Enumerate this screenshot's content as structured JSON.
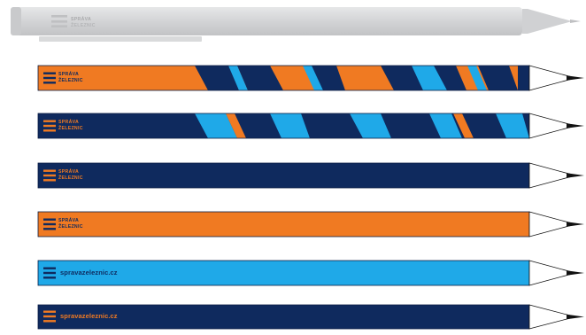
{
  "colors": {
    "navy": "#0f2a5e",
    "orange": "#f07a22",
    "cyan": "#1fa9e8",
    "pen_silver": "#cfd0d2",
    "pen_shadow": "#b8b9bb",
    "tip_white": "#ffffff",
    "graphite": "#111111"
  },
  "pen": {
    "brand_line1": "SPRÁVA",
    "brand_line2": "ŽELEZNIC"
  },
  "pencils": [
    {
      "name": "pencil-stripes-orange",
      "body": "stripes-orange",
      "brand_line1": "SPRÁVA",
      "brand_line2": "ŽELEZNIC",
      "text_color": "#0f2a5e",
      "logo_color": "#0f2a5e"
    },
    {
      "name": "pencil-stripes-navy",
      "body": "stripes-navy",
      "brand_line1": "SPRÁVA",
      "brand_line2": "ŽELEZNIC",
      "text_color": "#f07a22",
      "logo_color": "#f07a22"
    },
    {
      "name": "pencil-navy",
      "body": "#0f2a5e",
      "brand_line1": "SPRÁVA",
      "brand_line2": "ŽELEZNIC",
      "text_color": "#f07a22",
      "logo_color": "#f07a22"
    },
    {
      "name": "pencil-orange",
      "body": "#f07a22",
      "brand_line1": "SPRÁVA",
      "brand_line2": "ŽELEZNIC",
      "text_color": "#0f2a5e",
      "logo_color": "#0f2a5e"
    },
    {
      "name": "pencil-cyan",
      "body": "#1fa9e8",
      "url": "spravazeleznic.cz",
      "text_color": "#0f2a5e",
      "logo_color": "#0f2a5e"
    },
    {
      "name": "pencil-navy-url",
      "body": "#0f2a5e",
      "url": "spravazeleznic.cz",
      "text_color": "#f07a22",
      "logo_color": "#f07a22"
    }
  ]
}
